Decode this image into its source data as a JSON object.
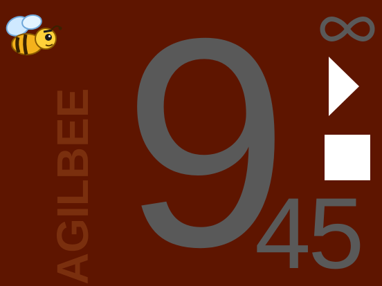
{
  "app": {
    "brand": "AGILBEE"
  },
  "timer": {
    "primary": "9",
    "secondary": "45"
  },
  "controls": {
    "loop_icon": "infinity-icon",
    "play_icon": "play-icon",
    "stop_icon": "stop-icon"
  },
  "colors": {
    "background": "#5e1500",
    "digits": "#595959",
    "brand_text": "#7a2f0e",
    "controls": "#ffffff"
  }
}
